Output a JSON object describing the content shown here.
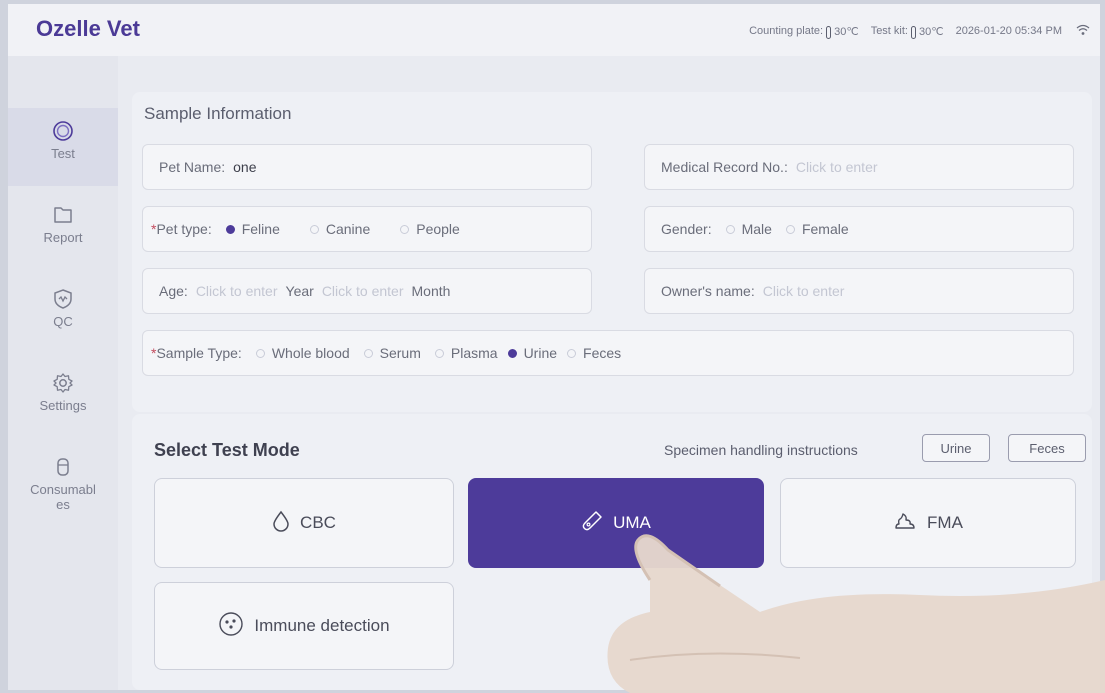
{
  "app": {
    "title": "Ozelle Vet"
  },
  "status": {
    "counting_plate_label": "Counting plate:",
    "counting_plate_temp": "30℃",
    "test_kit_label": "Test kit:",
    "test_kit_temp": "30℃",
    "datetime": "2026-01-20  05:34 PM"
  },
  "sidebar": {
    "items": [
      {
        "label": "Test",
        "icon": "test-icon",
        "active": true
      },
      {
        "label": "Report",
        "icon": "report-icon"
      },
      {
        "label": "QC",
        "icon": "qc-icon"
      },
      {
        "label": "Settings",
        "icon": "gear-icon"
      },
      {
        "label": "Consumables",
        "label_line1": "Consumabl",
        "label_line2": "es",
        "icon": "consumables-icon"
      }
    ]
  },
  "sample": {
    "title": "Sample Information",
    "pet_name": {
      "label": "Pet Name:",
      "value": "one"
    },
    "medical_record": {
      "label": "Medical Record No.:",
      "placeholder": "Click to enter"
    },
    "pet_type": {
      "label": "Pet type:",
      "options": [
        "Feline",
        "Canine",
        "People"
      ],
      "selected": "Feline"
    },
    "gender": {
      "label": "Gender:",
      "options": [
        "Male",
        "Female"
      ]
    },
    "age": {
      "label": "Age:",
      "placeholder": "Click to enter",
      "year_label": "Year",
      "month_label": "Month"
    },
    "owner": {
      "label": "Owner's name:",
      "placeholder": "Click to enter"
    },
    "sample_type": {
      "label": "Sample Type:",
      "options": [
        "Whole blood",
        "Serum",
        "Plasma",
        "Urine",
        "Feces"
      ],
      "selected": "Urine"
    }
  },
  "mode": {
    "title": "Select Test Mode",
    "specimen_label": "Specimen handling instructions",
    "specimen_buttons": [
      "Urine",
      "Feces"
    ],
    "buttons": [
      {
        "label": "CBC",
        "icon": "drop-icon"
      },
      {
        "label": "UMA",
        "icon": "test-tube-icon",
        "active": true
      },
      {
        "label": "FMA",
        "icon": "feces-icon"
      },
      {
        "label": "Immune detection",
        "icon": "immune-icon"
      }
    ]
  },
  "colors": {
    "accent": "#4d3b9a",
    "brand": "#4b3a96",
    "background": "#e9ebf1"
  }
}
